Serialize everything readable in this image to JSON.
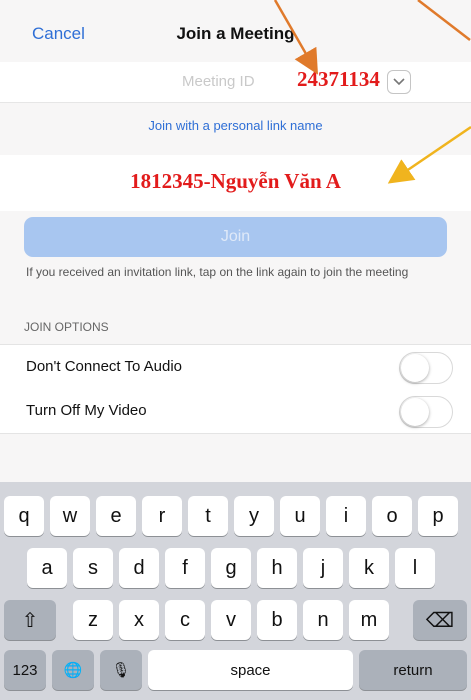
{
  "nav": {
    "cancel": "Cancel",
    "title": "Join a Meeting"
  },
  "meeting_id": {
    "placeholder": "Meeting ID",
    "value": "24371134"
  },
  "personal_link": "Join with a personal link name",
  "display_name": "1812345-Nguyễn Văn A",
  "join_button": "Join",
  "join_hint": "If you received an invitation link, tap on the link again to join the meeting",
  "options": {
    "title": "JOIN OPTIONS",
    "items": [
      {
        "label": "Don't Connect To Audio",
        "on": false
      },
      {
        "label": "Turn Off My Video",
        "on": false
      }
    ]
  },
  "keyboard": {
    "row1": [
      "q",
      "w",
      "e",
      "r",
      "t",
      "y",
      "u",
      "i",
      "o",
      "p"
    ],
    "row2": [
      "a",
      "s",
      "d",
      "f",
      "g",
      "h",
      "j",
      "k",
      "l"
    ],
    "row3": [
      "z",
      "x",
      "c",
      "v",
      "b",
      "n",
      "m"
    ],
    "shift": "⇧",
    "backspace": "⌫",
    "numbers": "123",
    "globe": "🌐",
    "mic": "🎙",
    "space": "space",
    "return": "return"
  },
  "colors": {
    "accent": "#2f6fd6",
    "annotation_text": "#e21b1b",
    "arrow_orange": "#e07a2b",
    "arrow_yellow": "#f0b41e"
  }
}
